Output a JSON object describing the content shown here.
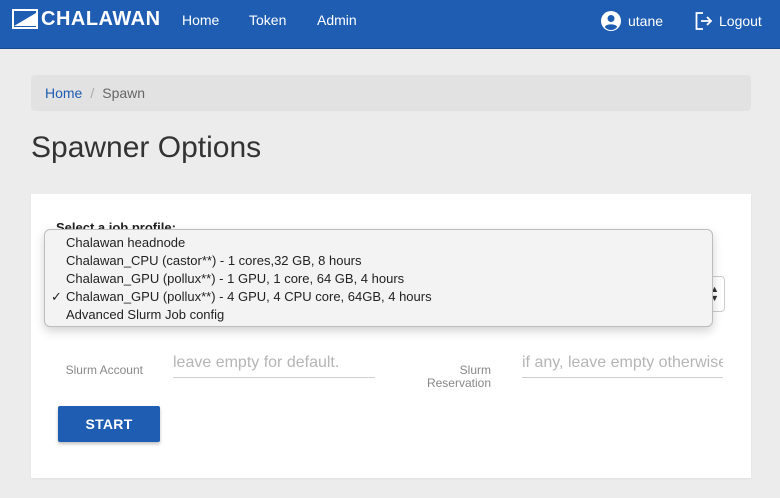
{
  "navbar": {
    "brand": "CHALAWAN",
    "links": [
      "Home",
      "Token",
      "Admin"
    ],
    "user": "utane",
    "logout": "Logout",
    "color": "#1e5db2"
  },
  "breadcrumb": {
    "home": "Home",
    "separator": "/",
    "current": "Spawn"
  },
  "page": {
    "title": "Spawner Options"
  },
  "form": {
    "profile_label": "Select a job profile:",
    "profile_options": [
      "Chalawan headnode",
      "Chalawan_CPU (castor**) - 1 cores,32 GB, 8 hours",
      "Chalawan_GPU (pollux**) - 1 GPU, 1 core, 64 GB, 4 hours",
      "Chalawan_GPU (pollux**) - 4 GPU, 4 CPU core, 64GB, 4 hours",
      "Advanced Slurm Job config"
    ],
    "selected_index": 3,
    "check_mark": "✓",
    "slurm_account_label": "Slurm Account",
    "slurm_account_placeholder": "leave empty for default.",
    "slurm_reservation_label_1": "Slurm",
    "slurm_reservation_label_2": "Reservation",
    "slurm_reservation_placeholder": "if any, leave empty otherwise",
    "start_label": "START"
  }
}
